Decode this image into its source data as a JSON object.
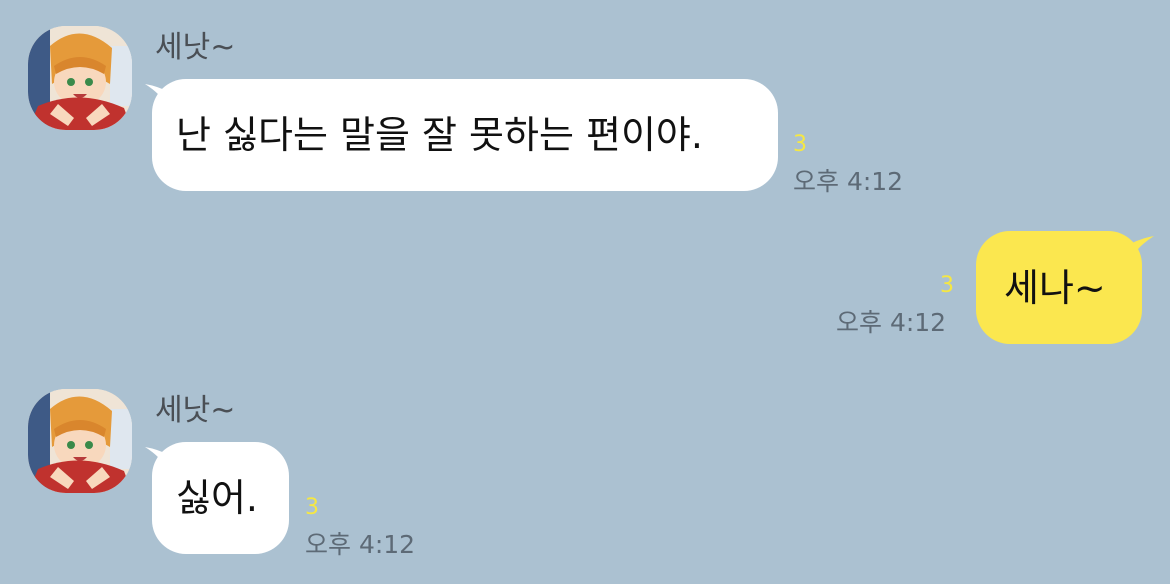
{
  "messages": [
    {
      "direction": "incoming",
      "sender": "세낫~",
      "text": "난 싫다는 말을 잘 못하는 편이야.",
      "unread": "3",
      "time": "오후 4:12"
    },
    {
      "direction": "outgoing",
      "text": "세나~",
      "unread": "3",
      "time": "오후 4:12"
    },
    {
      "direction": "incoming",
      "sender": "세낫~",
      "text": "싫어.",
      "unread": "3",
      "time": "오후 4:12"
    }
  ],
  "colors": {
    "background": "#abc1d1",
    "incoming_bubble": "#ffffff",
    "outgoing_bubble": "#fbe74f",
    "unread_count": "#f5e743",
    "timestamp": "#5d6a76"
  },
  "icons": {
    "avatar": "character-avatar"
  }
}
